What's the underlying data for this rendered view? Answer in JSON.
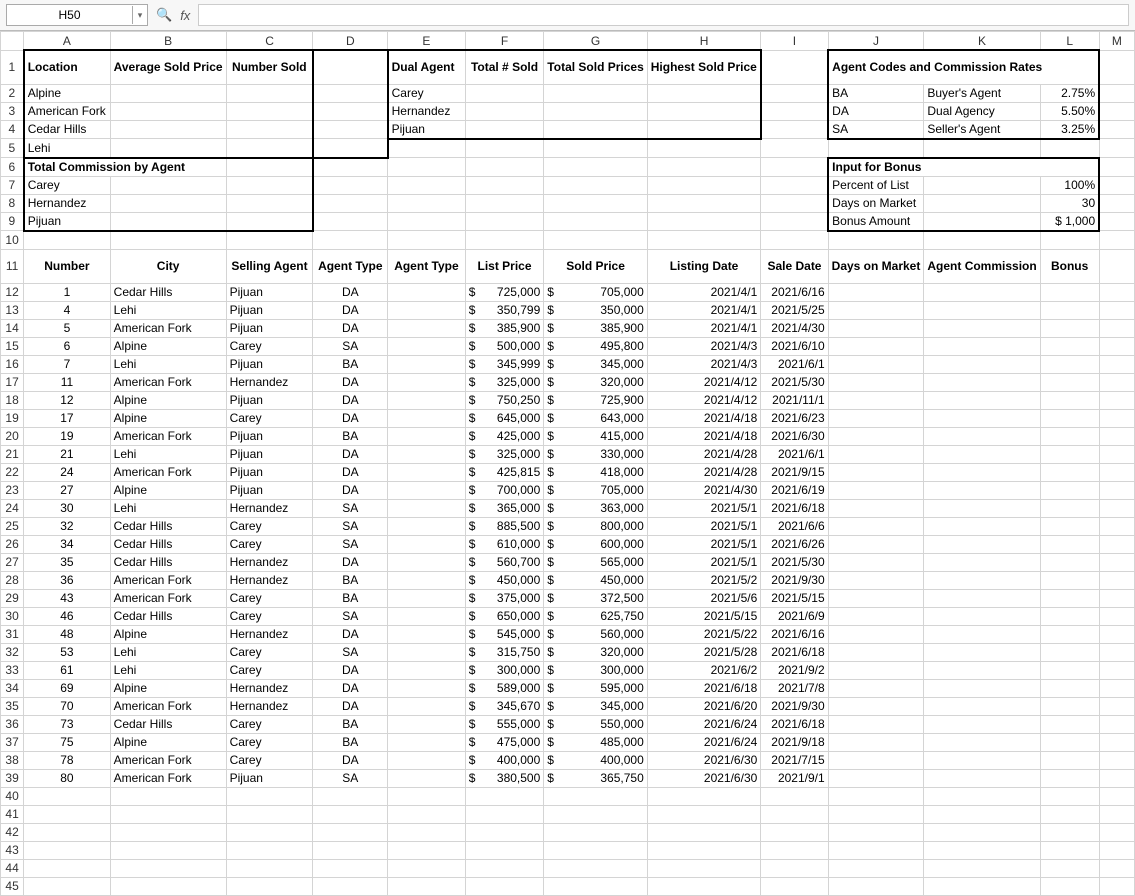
{
  "toolbar": {
    "cellref": "H50",
    "fx": "fx"
  },
  "cols": [
    "A",
    "B",
    "C",
    "D",
    "E",
    "F",
    "G",
    "H",
    "I",
    "J",
    "K",
    "L",
    "M"
  ],
  "hdr1": {
    "A": "Location",
    "B": "Average Sold Price",
    "C": "Number Sold",
    "E": "Dual Agent",
    "F": "Total # Sold",
    "G": "Total Sold Prices",
    "H": "Highest Sold Price",
    "J": "Agent Codes and Commission Rates"
  },
  "loc": [
    "Alpine",
    "American Fork",
    "Cedar Hills",
    "Lehi"
  ],
  "dual": [
    "Carey",
    "Hernandez",
    "Pijuan"
  ],
  "codes": [
    [
      "BA",
      "Buyer's Agent",
      "2.75%"
    ],
    [
      "DA",
      "Dual Agency",
      "5.50%"
    ],
    [
      "SA",
      "Seller's Agent",
      "3.25%"
    ]
  ],
  "tcba_title": "Total Commission by Agent",
  "tcba": [
    "Carey",
    "Hernandez",
    "Pijuan"
  ],
  "bonus_hdr": "Input for Bonus",
  "bonus": [
    [
      "Percent of List",
      "100%"
    ],
    [
      "Days on Market",
      "30"
    ],
    [
      "Bonus Amount",
      "$    1,000"
    ]
  ],
  "cols11": {
    "A": "Number",
    "B": "City",
    "C": "Selling Agent",
    "D": "Agent Type",
    "E": "Agent Type",
    "F": "List Price",
    "G": "Sold Price",
    "H": "Listing Date",
    "I": "Sale Date",
    "J": "Days on Market",
    "K": "Agent Commission",
    "L": "Bonus"
  },
  "rows": [
    {
      "n": "1",
      "city": "Cedar Hills",
      "agent": "Pijuan",
      "type": "DA",
      "lp": "725,000",
      "sp": "705,000",
      "ld": "2021/4/1",
      "sd": "2021/6/16"
    },
    {
      "n": "4",
      "city": "Lehi",
      "agent": "Pijuan",
      "type": "DA",
      "lp": "350,799",
      "sp": "350,000",
      "ld": "2021/4/1",
      "sd": "2021/5/25"
    },
    {
      "n": "5",
      "city": "American Fork",
      "agent": "Pijuan",
      "type": "DA",
      "lp": "385,900",
      "sp": "385,900",
      "ld": "2021/4/1",
      "sd": "2021/4/30"
    },
    {
      "n": "6",
      "city": "Alpine",
      "agent": "Carey",
      "type": "SA",
      "lp": "500,000",
      "sp": "495,800",
      "ld": "2021/4/3",
      "sd": "2021/6/10"
    },
    {
      "n": "7",
      "city": "Lehi",
      "agent": "Pijuan",
      "type": "BA",
      "lp": "345,999",
      "sp": "345,000",
      "ld": "2021/4/3",
      "sd": "2021/6/1"
    },
    {
      "n": "11",
      "city": "American Fork",
      "agent": "Hernandez",
      "type": "DA",
      "lp": "325,000",
      "sp": "320,000",
      "ld": "2021/4/12",
      "sd": "2021/5/30"
    },
    {
      "n": "12",
      "city": "Alpine",
      "agent": "Pijuan",
      "type": "DA",
      "lp": "750,250",
      "sp": "725,900",
      "ld": "2021/4/12",
      "sd": "2021/11/1"
    },
    {
      "n": "17",
      "city": "Alpine",
      "agent": "Carey",
      "type": "DA",
      "lp": "645,000",
      "sp": "643,000",
      "ld": "2021/4/18",
      "sd": "2021/6/23"
    },
    {
      "n": "19",
      "city": "American Fork",
      "agent": "Pijuan",
      "type": "BA",
      "lp": "425,000",
      "sp": "415,000",
      "ld": "2021/4/18",
      "sd": "2021/6/30"
    },
    {
      "n": "21",
      "city": "Lehi",
      "agent": "Pijuan",
      "type": "DA",
      "lp": "325,000",
      "sp": "330,000",
      "ld": "2021/4/28",
      "sd": "2021/6/1"
    },
    {
      "n": "24",
      "city": "American Fork",
      "agent": "Pijuan",
      "type": "DA",
      "lp": "425,815",
      "sp": "418,000",
      "ld": "2021/4/28",
      "sd": "2021/9/15"
    },
    {
      "n": "27",
      "city": "Alpine",
      "agent": "Pijuan",
      "type": "DA",
      "lp": "700,000",
      "sp": "705,000",
      "ld": "2021/4/30",
      "sd": "2021/6/19"
    },
    {
      "n": "30",
      "city": "Lehi",
      "agent": "Hernandez",
      "type": "SA",
      "lp": "365,000",
      "sp": "363,000",
      "ld": "2021/5/1",
      "sd": "2021/6/18"
    },
    {
      "n": "32",
      "city": "Cedar Hills",
      "agent": "Carey",
      "type": "SA",
      "lp": "885,500",
      "sp": "800,000",
      "ld": "2021/5/1",
      "sd": "2021/6/6"
    },
    {
      "n": "34",
      "city": "Cedar Hills",
      "agent": "Carey",
      "type": "SA",
      "lp": "610,000",
      "sp": "600,000",
      "ld": "2021/5/1",
      "sd": "2021/6/26"
    },
    {
      "n": "35",
      "city": "Cedar Hills",
      "agent": "Hernandez",
      "type": "DA",
      "lp": "560,700",
      "sp": "565,000",
      "ld": "2021/5/1",
      "sd": "2021/5/30"
    },
    {
      "n": "36",
      "city": "American Fork",
      "agent": "Hernandez",
      "type": "BA",
      "lp": "450,000",
      "sp": "450,000",
      "ld": "2021/5/2",
      "sd": "2021/9/30"
    },
    {
      "n": "43",
      "city": "American Fork",
      "agent": "Carey",
      "type": "BA",
      "lp": "375,000",
      "sp": "372,500",
      "ld": "2021/5/6",
      "sd": "2021/5/15"
    },
    {
      "n": "46",
      "city": "Cedar Hills",
      "agent": "Carey",
      "type": "SA",
      "lp": "650,000",
      "sp": "625,750",
      "ld": "2021/5/15",
      "sd": "2021/6/9"
    },
    {
      "n": "48",
      "city": "Alpine",
      "agent": "Hernandez",
      "type": "DA",
      "lp": "545,000",
      "sp": "560,000",
      "ld": "2021/5/22",
      "sd": "2021/6/16"
    },
    {
      "n": "53",
      "city": "Lehi",
      "agent": "Carey",
      "type": "SA",
      "lp": "315,750",
      "sp": "320,000",
      "ld": "2021/5/28",
      "sd": "2021/6/18"
    },
    {
      "n": "61",
      "city": "Lehi",
      "agent": "Carey",
      "type": "DA",
      "lp": "300,000",
      "sp": "300,000",
      "ld": "2021/6/2",
      "sd": "2021/9/2"
    },
    {
      "n": "69",
      "city": "Alpine",
      "agent": "Hernandez",
      "type": "DA",
      "lp": "589,000",
      "sp": "595,000",
      "ld": "2021/6/18",
      "sd": "2021/7/8"
    },
    {
      "n": "70",
      "city": "American Fork",
      "agent": "Hernandez",
      "type": "DA",
      "lp": "345,670",
      "sp": "345,000",
      "ld": "2021/6/20",
      "sd": "2021/9/30"
    },
    {
      "n": "73",
      "city": "Cedar Hills",
      "agent": "Carey",
      "type": "BA",
      "lp": "555,000",
      "sp": "550,000",
      "ld": "2021/6/24",
      "sd": "2021/6/18"
    },
    {
      "n": "75",
      "city": "Alpine",
      "agent": "Carey",
      "type": "BA",
      "lp": "475,000",
      "sp": "485,000",
      "ld": "2021/6/24",
      "sd": "2021/9/18"
    },
    {
      "n": "78",
      "city": "American Fork",
      "agent": "Carey",
      "type": "DA",
      "lp": "400,000",
      "sp": "400,000",
      "ld": "2021/6/30",
      "sd": "2021/7/15"
    },
    {
      "n": "80",
      "city": "American Fork",
      "agent": "Pijuan",
      "type": "SA",
      "lp": "380,500",
      "sp": "365,750",
      "ld": "2021/6/30",
      "sd": "2021/9/1"
    }
  ]
}
